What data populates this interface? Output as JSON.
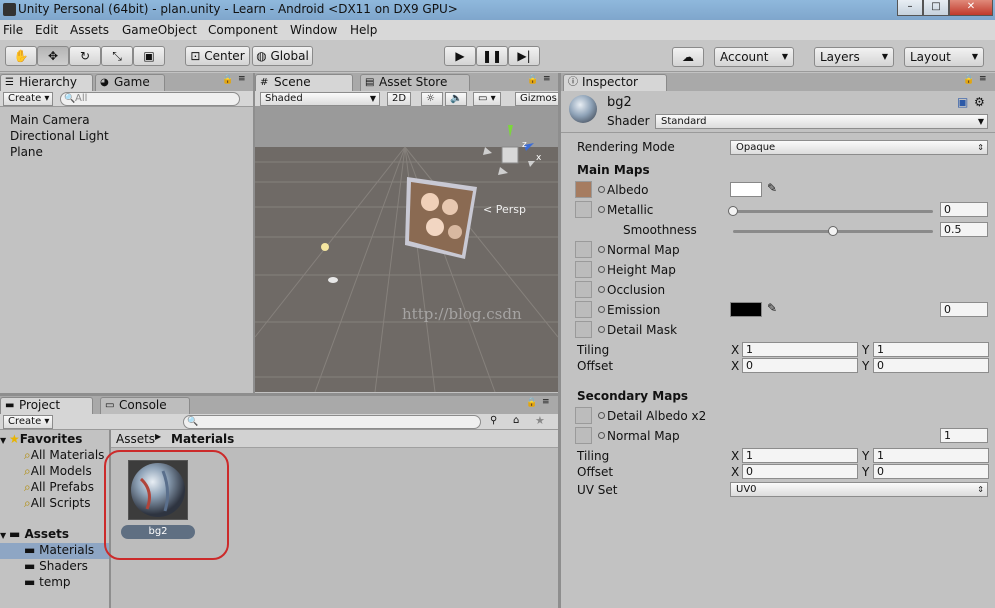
{
  "window": {
    "title": "Unity Personal (64bit) - plan.unity - Learn - Android <DX11 on DX9 GPU>"
  },
  "menu": [
    "File",
    "Edit",
    "Assets",
    "GameObject",
    "Component",
    "Window",
    "Help"
  ],
  "toolbar": {
    "center_label": "Center",
    "global_label": "Global",
    "account_label": "Account",
    "layers_label": "Layers",
    "layout_label": "Layout"
  },
  "hierarchy": {
    "tab_label": "Hierarchy",
    "game_tab_label": "Game",
    "create_label": "Create",
    "search_placeholder": "All",
    "items": [
      "Main Camera",
      "Directional Light",
      "Plane"
    ]
  },
  "scene": {
    "tab_label": "Scene",
    "asset_store_tab_label": "Asset Store",
    "shading_mode": "Shaded",
    "mode_2d": "2D",
    "gizmos_label": "Gizmos",
    "persp_label": "Persp",
    "watermark": "http://blog.csdn"
  },
  "project": {
    "tab_label": "Project",
    "console_tab_label": "Console",
    "create_label": "Create",
    "favorites_label": "Favorites",
    "favorites": [
      "All Materials",
      "All Models",
      "All Prefabs",
      "All Scripts"
    ],
    "assets_label": "Assets",
    "folders": [
      "Materials",
      "Shaders",
      "temp"
    ],
    "breadcrumb": {
      "root": "Assets",
      "current": "Materials"
    },
    "asset_name": "bg2"
  },
  "inspector": {
    "tab_label": "Inspector",
    "material_name": "bg2",
    "shader_label": "Shader",
    "shader_value": "Standard",
    "rendering_mode_label": "Rendering Mode",
    "rendering_mode_value": "Opaque",
    "main_maps_label": "Main Maps",
    "albedo_label": "Albedo",
    "metallic_label": "Metallic",
    "metallic_value": "0",
    "metallic_fraction": 0,
    "smoothness_label": "Smoothness",
    "smoothness_value": "0.5",
    "smoothness_fraction": 0.5,
    "normal_map_label": "Normal Map",
    "height_map_label": "Height Map",
    "occlusion_label": "Occlusion",
    "emission_label": "Emission",
    "emission_value": "0",
    "detail_mask_label": "Detail Mask",
    "tiling_label": "Tiling",
    "offset_label": "Offset",
    "x_label": "X",
    "y_label": "Y",
    "tiling_x": "1",
    "tiling_y": "1",
    "offset_x": "0",
    "offset_y": "0",
    "secondary_maps_label": "Secondary Maps",
    "detail_albedo_label": "Detail Albedo x2",
    "secondary_normal_label": "Normal Map",
    "secondary_normal_value": "1",
    "secondary_tiling_x": "1",
    "secondary_tiling_y": "1",
    "secondary_offset_x": "0",
    "secondary_offset_y": "0",
    "uv_set_label": "UV Set",
    "uv_set_value": "UV0"
  },
  "colors": {
    "albedo": "#ffffff",
    "emission": "#000000",
    "scene_bg": "#6f6a66",
    "highlight_circle": "#cc2a2a"
  }
}
